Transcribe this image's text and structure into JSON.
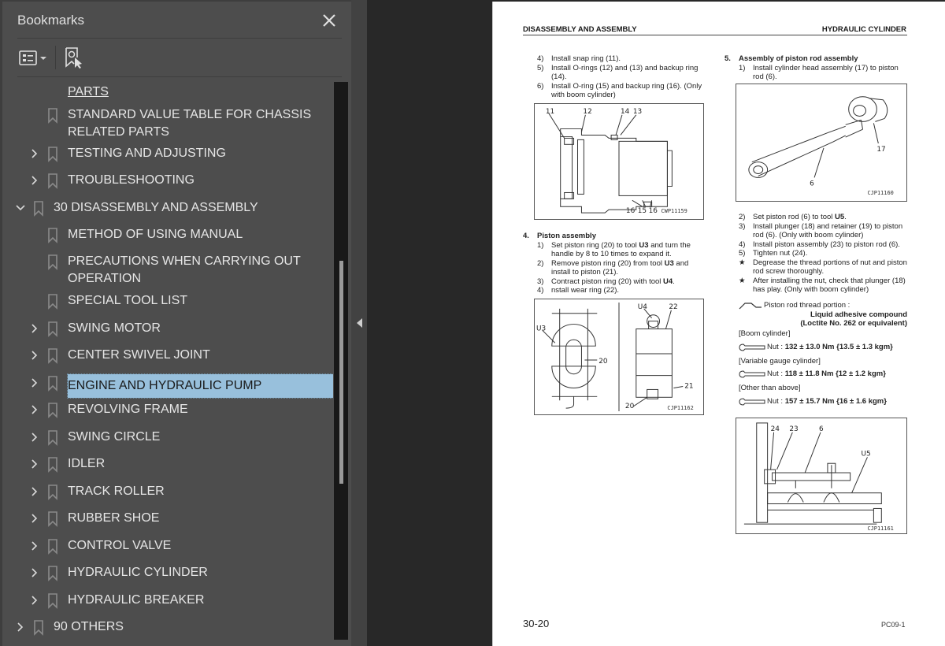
{
  "panel": {
    "title": "Bookmarks",
    "close_icon": "close-icon",
    "options_icon": "bookmark-options-icon",
    "find_icon": "find-current-bookmark-icon"
  },
  "bookmarks": [
    {
      "label": "PARTS",
      "level": 2,
      "expandable": false,
      "hovered": true
    },
    {
      "label": "STANDARD VALUE TABLE FOR CHASSIS RELATED PARTS",
      "level": 2,
      "expandable": false
    },
    {
      "label": "TESTING AND ADJUSTING",
      "level": 2,
      "expandable": true,
      "expanded": false
    },
    {
      "label": "TROUBLESHOOTING",
      "level": 2,
      "expandable": true,
      "expanded": false
    },
    {
      "label": "30 DISASSEMBLY AND ASSEMBLY",
      "level": 1,
      "expandable": true,
      "expanded": true
    },
    {
      "label": "METHOD OF USING MANUAL",
      "level": 2,
      "expandable": false
    },
    {
      "label": "PRECAUTIONS WHEN CARRYING OUT OPERATION",
      "level": 2,
      "expandable": false
    },
    {
      "label": "SPECIAL TOOL LIST",
      "level": 2,
      "expandable": false
    },
    {
      "label": "SWING MOTOR",
      "level": 2,
      "expandable": true,
      "expanded": false
    },
    {
      "label": "CENTER SWIVEL JOINT",
      "level": 2,
      "expandable": true,
      "expanded": false
    },
    {
      "label": "ENGINE AND HYDRAULIC PUMP",
      "level": 2,
      "expandable": true,
      "expanded": false,
      "selected": true
    },
    {
      "label": "REVOLVING FRAME",
      "level": 2,
      "expandable": true,
      "expanded": false
    },
    {
      "label": "SWING CIRCLE",
      "level": 2,
      "expandable": true,
      "expanded": false
    },
    {
      "label": "IDLER",
      "level": 2,
      "expandable": true,
      "expanded": false
    },
    {
      "label": "TRACK ROLLER",
      "level": 2,
      "expandable": true,
      "expanded": false
    },
    {
      "label": "RUBBER SHOE",
      "level": 2,
      "expandable": true,
      "expanded": false
    },
    {
      "label": "CONTROL VALVE",
      "level": 2,
      "expandable": true,
      "expanded": false
    },
    {
      "label": "HYDRAULIC CYLINDER",
      "level": 2,
      "expandable": true,
      "expanded": false
    },
    {
      "label": "HYDRAULIC BREAKER",
      "level": 2,
      "expandable": true,
      "expanded": false
    },
    {
      "label": "90 OTHERS",
      "level": 1,
      "expandable": true,
      "expanded": false
    }
  ],
  "colors": {
    "panel_bg": "#4d4d4d",
    "selection": "#98c0dc",
    "viewer_bg": "#282828"
  },
  "document": {
    "header_left": "DISASSEMBLY AND ASSEMBLY",
    "header_right": "HYDRAULIC CYLINDER",
    "left_top_steps": [
      {
        "n": "4)",
        "text": "Install snap ring (11)."
      },
      {
        "n": "5)",
        "text": "Install O-rings (12) and (13) and backup ring (14)."
      },
      {
        "n": "6)",
        "text": "Install O-ring (15) and backup ring (16). (Only with boom cylinder)"
      }
    ],
    "fig1": {
      "code": "CWP11159",
      "callouts": [
        "11",
        "12",
        "14",
        "13",
        "16",
        "15",
        "16"
      ]
    },
    "sec4": {
      "n": "4.",
      "title": "Piston assembly",
      "steps": [
        {
          "n": "1)",
          "pre": "Set piston ring (20) to tool ",
          "bold": "U3",
          "post": " and turn the handle by 8 to 10 times to expand it."
        },
        {
          "n": "2)",
          "pre": "Remove piston ring (20) from tool ",
          "bold": "U3",
          "post": " and install to piston (21)."
        },
        {
          "n": "3)",
          "pre": "Contract piston ring (20) with tool ",
          "bold": "U4",
          "post": "."
        },
        {
          "n": "4)",
          "pre": "nstall wear ring (22).",
          "bold": "",
          "post": ""
        }
      ]
    },
    "fig2": {
      "code": "CJP11162",
      "callouts": [
        "U3",
        "20",
        "U4",
        "22",
        "21",
        "20"
      ]
    },
    "sec5": {
      "n": "5.",
      "title": "Assembly of piston rod assembly",
      "step1": {
        "n": "1)",
        "text": "Install cylinder head assembly (17) to piston rod (6)."
      }
    },
    "fig3": {
      "code": "CJP11160",
      "callouts": [
        "17",
        "6"
      ]
    },
    "sec5_steps": [
      {
        "n": "2)",
        "pre": "Set piston rod (6) to tool ",
        "bold": "U5",
        "post": "."
      },
      {
        "n": "3)",
        "pre": "Install plunger (18) and retainer (19) to piston rod (6). (Only with boom cylinder)",
        "bold": "",
        "post": ""
      },
      {
        "n": "4)",
        "pre": "Install piston assembly (23) to piston rod (6).",
        "bold": "",
        "post": ""
      },
      {
        "n": "5)",
        "pre": "Tighten nut (24).",
        "bold": "",
        "post": ""
      },
      {
        "n": "★",
        "pre": "Degrease the thread portions of nut and piston rod screw thoroughly.",
        "bold": "",
        "post": ""
      },
      {
        "n": "★",
        "pre": "After installing the nut, check that plunger (18) has play. (Only with boom cylinder)",
        "bold": "",
        "post": ""
      }
    ],
    "adhesive": {
      "label": "Piston rod thread portion :",
      "line1": "Liquid adhesive compound",
      "line2": "(Loctite No. 262 or equivalent)"
    },
    "torques": [
      {
        "condition": "[Boom cylinder]",
        "label": "Nut : ",
        "value": "132 ± 13.0 Nm {13.5 ± 1.3 kgm}"
      },
      {
        "condition": "[Variable gauge cylinder]",
        "label": "Nut : ",
        "value": "118 ± 11.8 Nm {12 ± 1.2 kgm}"
      },
      {
        "condition": "[Other than above]",
        "label": "Nut : ",
        "value": "157 ± 15.7 Nm {16 ± 1.6 kgm}"
      }
    ],
    "fig4": {
      "code": "CJP11161",
      "callouts": [
        "24",
        "23",
        "6",
        "U5"
      ]
    },
    "page_number": "30-20",
    "page_code": "PC09-1"
  },
  "scroll": {
    "thumb_start_fraction": 0.32,
    "thumb_size_fraction": 0.4
  }
}
